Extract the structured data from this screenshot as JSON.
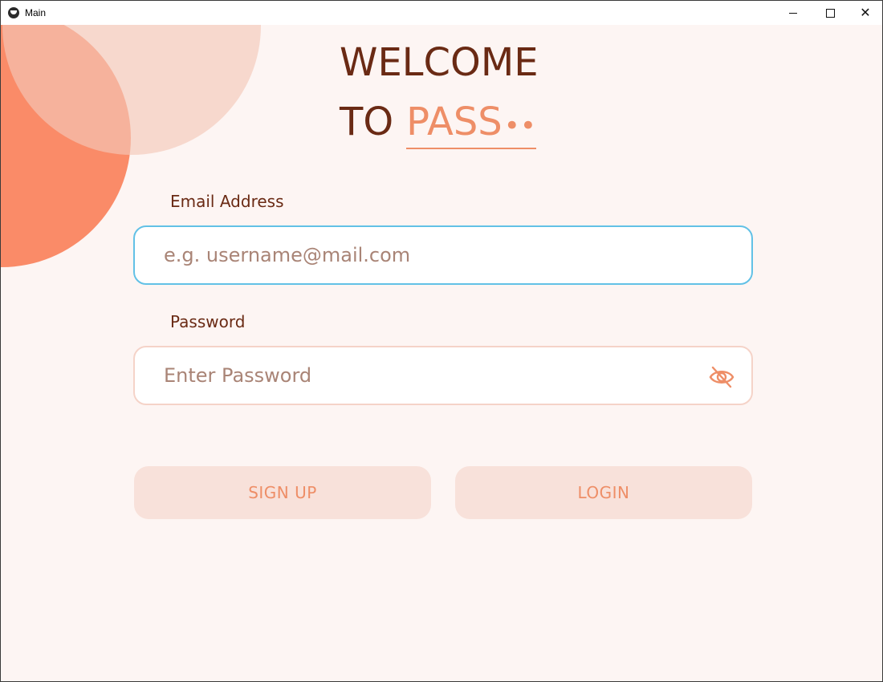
{
  "window": {
    "title": "Main"
  },
  "heading": {
    "line1": "WELCOME",
    "line2_prefix": "TO",
    "brand": "PASS",
    "brand_dots": "••"
  },
  "form": {
    "email": {
      "label": "Email Address",
      "placeholder": "e.g. username@mail.com",
      "value": ""
    },
    "password": {
      "label": "Password",
      "placeholder": "Enter Password",
      "value": "",
      "visibility_icon": "eye-off-icon"
    }
  },
  "actions": {
    "signup_label": "SIGN UP",
    "login_label": "LOGIN"
  },
  "colors": {
    "background": "#fdf5f3",
    "accent": "#ee8e67",
    "heading": "#6a2a14",
    "focus_border": "#62c1e6",
    "button_bg": "#f8e1da"
  }
}
